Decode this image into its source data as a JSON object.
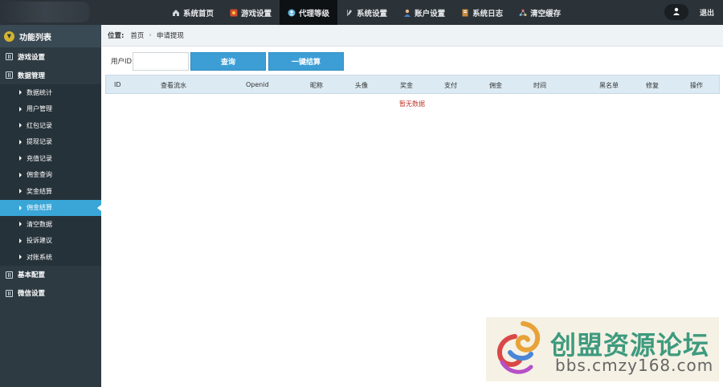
{
  "topnav": {
    "items": [
      {
        "label": "系统首页",
        "icon": "home-icon"
      },
      {
        "label": "游戏设置",
        "icon": "game-icon"
      },
      {
        "label": "代理等级",
        "icon": "agent-icon",
        "active": true
      },
      {
        "label": "系统设置",
        "icon": "tools-icon"
      },
      {
        "label": "账户设置",
        "icon": "account-icon"
      },
      {
        "label": "系统日志",
        "icon": "log-icon"
      },
      {
        "label": "清空缓存",
        "icon": "cache-icon"
      }
    ],
    "logout": "退出"
  },
  "sidebar": {
    "title": "功能列表",
    "groups": [
      {
        "label": "游戏设置"
      },
      {
        "label": "数据管理"
      }
    ],
    "subitems": [
      "数据统计",
      "用户管理",
      "红包记录",
      "提现记录",
      "充值记录",
      "佣金查询",
      "奖金结算",
      "佣金结算",
      "清空数据",
      "投诉建议",
      "对账系统"
    ],
    "active_subitem": "佣金结算",
    "groups_after": [
      {
        "label": "基本配置"
      },
      {
        "label": "微信设置"
      }
    ]
  },
  "breadcrumb": {
    "label": "位置:",
    "home": "首页",
    "current": "申请提现"
  },
  "search": {
    "field_label": "用户ID",
    "value": "",
    "query_button": "查询",
    "settle_button": "一键结算"
  },
  "table": {
    "columns": [
      "ID",
      "查看流水",
      "Openid",
      "昵称",
      "头像",
      "奖金",
      "支付",
      "佣金",
      "时间",
      "黑名单",
      "修复",
      "操作"
    ],
    "empty_text": "暂无数据"
  },
  "watermark": {
    "title": "创盟资源论坛",
    "url": "bbs.cmzy168.com"
  },
  "colors": {
    "topbar": "#2b3238",
    "sidebar": "#2d3a42",
    "active_item": "#3aa6d8",
    "button": "#3d9ed6",
    "table_head": "#dbeaf3",
    "empty_text": "#c0392b"
  }
}
